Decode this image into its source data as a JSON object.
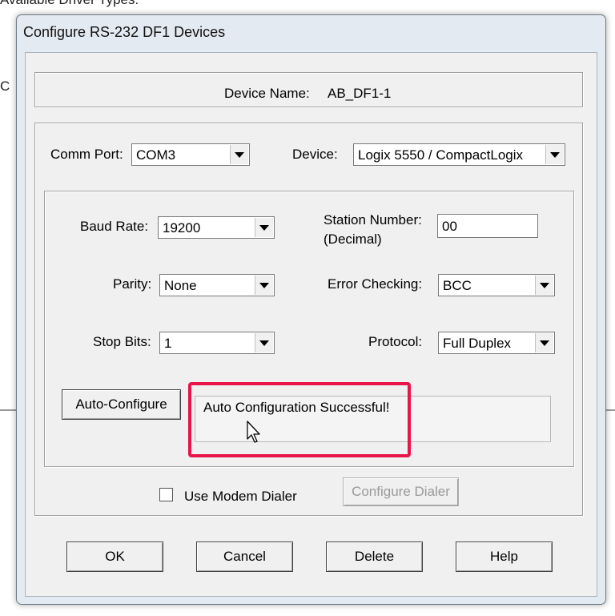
{
  "background": {
    "partial_text": "Available Driver Types:",
    "partial_letter": "C"
  },
  "dialog": {
    "title": "Configure RS-232 DF1 Devices"
  },
  "device_name": {
    "label": "Device Name:",
    "value": "AB_DF1-1"
  },
  "comm_port": {
    "label": "Comm Port:",
    "value": "COM3"
  },
  "device": {
    "label": "Device:",
    "value": "Logix 5550 / CompactLogix"
  },
  "baud_rate": {
    "label": "Baud Rate:",
    "value": "19200"
  },
  "station_number": {
    "label_line1": "Station Number:",
    "label_line2": "(Decimal)",
    "value": "00"
  },
  "parity": {
    "label": "Parity:",
    "value": "None"
  },
  "error_checking": {
    "label": "Error Checking:",
    "value": "BCC"
  },
  "stop_bits": {
    "label": "Stop Bits:",
    "value": "1"
  },
  "protocol": {
    "label": "Protocol:",
    "value": "Full Duplex"
  },
  "auto_configure": {
    "button_label": "Auto-Configure",
    "status_text": "Auto Configuration Successful!"
  },
  "modem": {
    "checkbox_label": "Use Modem Dialer",
    "checked": false,
    "configure_dialer_label": "Configure Dialer"
  },
  "buttons": {
    "ok": "OK",
    "cancel": "Cancel",
    "delete": "Delete",
    "help": "Help"
  },
  "colors": {
    "highlight": "#e8154b",
    "dialog_frame": "#e4eaf1",
    "client_bg": "#f0f0f0"
  }
}
